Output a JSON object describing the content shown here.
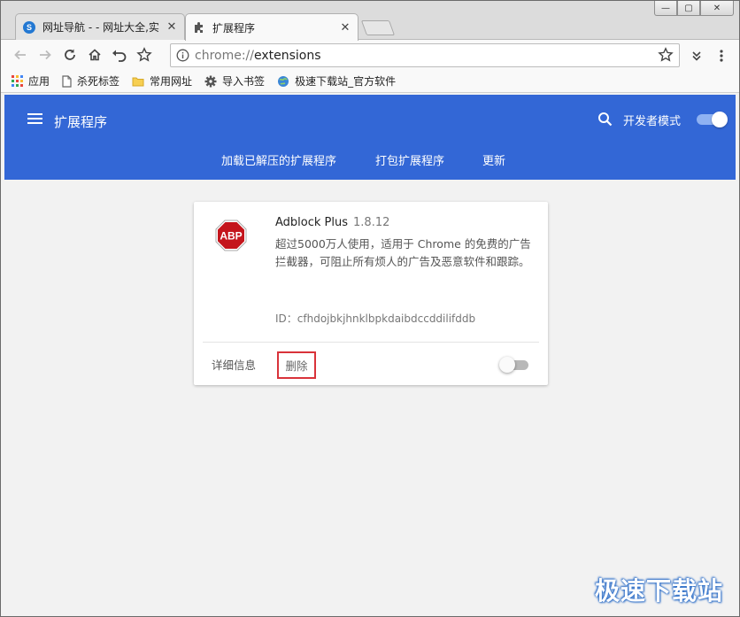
{
  "window": {
    "controls": [
      "—",
      "▢",
      "✕"
    ]
  },
  "tabs": [
    {
      "title": "网址导航 - - 网址大全,实",
      "icon": "search-brand-icon",
      "active": false
    },
    {
      "title": "扩展程序",
      "icon": "puzzle-icon",
      "active": true
    }
  ],
  "omnibox": {
    "scheme": "chrome://",
    "path": "extensions"
  },
  "bookmarks": [
    {
      "label": "应用",
      "icon": "apps-grid-icon"
    },
    {
      "label": "杀死标签",
      "icon": "page-icon"
    },
    {
      "label": "常用网址",
      "icon": "folder-icon"
    },
    {
      "label": "导入书签",
      "icon": "gear-icon"
    },
    {
      "label": "极速下载站_官方软件",
      "icon": "globe-icon"
    }
  ],
  "header": {
    "title": "扩展程序",
    "dev_mode_label": "开发者模式",
    "dev_mode_on": true,
    "links": [
      "加载已解压的扩展程序",
      "打包扩展程序",
      "更新"
    ]
  },
  "extension": {
    "icon_text": "ABP",
    "name": "Adblock Plus",
    "version": "1.8.12",
    "description": "超过5000万人使用，适用于 Chrome 的免费的广告拦截器，可阻止所有烦人的广告及恶意软件和跟踪。",
    "id_label": "ID：cfhdojbkjhnklbpkdaibdccddilifddb",
    "details_label": "详细信息",
    "remove_label": "删除",
    "enabled": false
  },
  "watermark": "极速下载站",
  "colors": {
    "header_bg": "#3367d6",
    "highlight_border": "#d9333a",
    "abp_red": "#c4151c"
  }
}
